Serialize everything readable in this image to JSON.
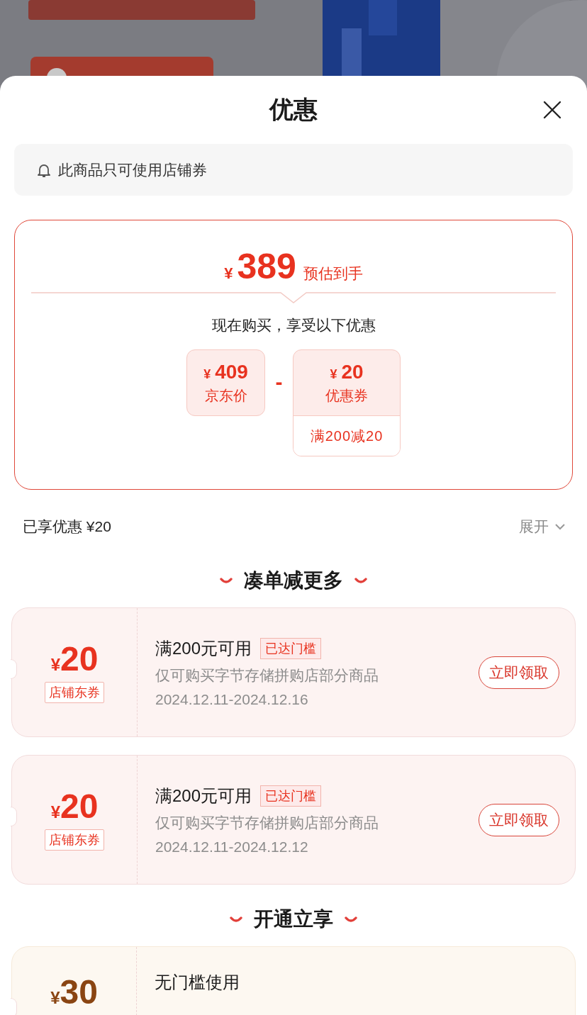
{
  "sheet": {
    "title": "优惠",
    "notice": "此商品只可使用店铺券"
  },
  "summary": {
    "currency": "¥",
    "price": "389",
    "price_note": "预估到手",
    "subtitle": "现在购买，享受以下优惠",
    "items": [
      {
        "kind": "price",
        "currency": "¥",
        "amount": "409",
        "label": "京东价"
      },
      {
        "kind": "operator",
        "symbol": "-"
      },
      {
        "kind": "coupon",
        "currency": "¥",
        "amount": "20",
        "label": "优惠券",
        "condition": "满200减20"
      }
    ]
  },
  "enjoyed": {
    "label": "已享优惠 ¥20",
    "toggle": "展开",
    "expanded": false
  },
  "sections": [
    {
      "heading": "凑单减更多",
      "coupons": [
        {
          "kind": "shop",
          "currency": "¥",
          "amount": "20",
          "type_tag": "店铺东券",
          "title": "满200元可用",
          "status": "已达门槛",
          "scope": "仅可购买字节存储拼购店部分商品",
          "validity": "2024.12.11-2024.12.16",
          "action": "立即领取"
        },
        {
          "kind": "shop",
          "currency": "¥",
          "amount": "20",
          "type_tag": "店铺东券",
          "title": "满200元可用",
          "status": "已达门槛",
          "scope": "仅可购买字节存储拼购店部分商品",
          "validity": "2024.12.11-2024.12.12",
          "action": "立即领取"
        }
      ]
    },
    {
      "heading": "开通立享",
      "coupons": [
        {
          "kind": "member",
          "currency": "¥",
          "amount": "30",
          "title": "无门槛使用"
        }
      ]
    }
  ]
}
